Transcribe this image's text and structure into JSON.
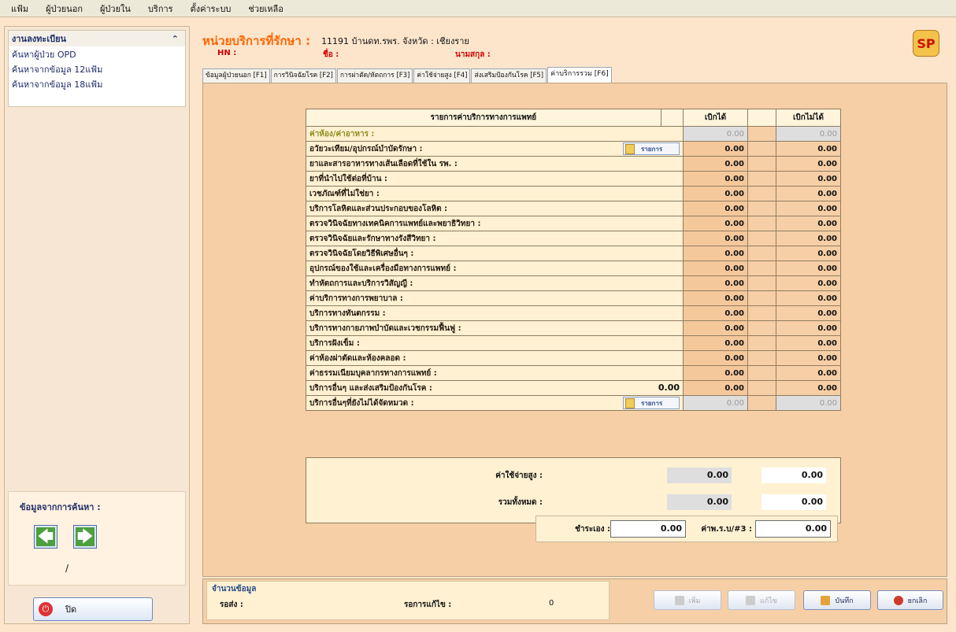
{
  "menu": [
    "แฟ้ม",
    "ผู้ป่วยนอก",
    "ผู้ป่วยใน",
    "บริการ",
    "ตั้งค่าระบบ",
    "ช่วยเหลือ"
  ],
  "sidebar": {
    "title": "งานลงทะเบียน",
    "items": [
      "ค้นหาผู้ป่วย OPD",
      "ค้นหาจากข้อมูล 12แฟ้ม",
      "ค้นหาจากข้อมูล 18แฟ้ม"
    ],
    "search_panel_label": "ข้อมูลจากการค้นหา :",
    "slash": "/",
    "close_label": "ปิด"
  },
  "header": {
    "unit_label": "หน่วยบริการที่รักษา :",
    "unit_value": "11191 บ้านดท.รพร. จังหวัด : เชียงราย",
    "hn_label": "HN :",
    "name_label": "ชื่อ :",
    "surname_label": "นามสกุล :",
    "logo_text": "SP"
  },
  "tabs": [
    "ข้อมูลผู้ป่วยนอก [F1]",
    "การวินิจฉัยโรค [F2]",
    "การผ่าตัด/หัตถการ [F3]",
    "ค่าใช้จ่ายสูง [F4]",
    "ส่งเสริมป้องกันโรค [F5]",
    "ค่าบริการรวม [F6]"
  ],
  "table": {
    "headers": [
      "รายการค่าบริการทางการแพทย์",
      "เบิกได้",
      "เบิกไม่ได้"
    ],
    "list_button_label": "รายการ",
    "rows": [
      {
        "name": "ค่าห้อง/ค่าอาหาร :",
        "a": "0.00",
        "b": "0.00"
      },
      {
        "name": "อวัยวะเทียม/อุปกรณ์บำบัดรักษา :",
        "a": "0.00",
        "b": "0.00"
      },
      {
        "name": "ยาและสารอาหารทางเส้นเลือดที่ใช้ใน รพ. :",
        "a": "0.00",
        "b": "0.00"
      },
      {
        "name": "ยาที่นำไปใช้ต่อที่บ้าน :",
        "a": "0.00",
        "b": "0.00"
      },
      {
        "name": "เวชภัณฑ์ที่ไม่ใช่ยา :",
        "a": "0.00",
        "b": "0.00"
      },
      {
        "name": "บริการโลหิตและส่วนประกอบของโลหิต :",
        "a": "0.00",
        "b": "0.00"
      },
      {
        "name": "ตรวจวินิจฉัยทางเทคนิคการแพทย์และพยาธิวิทยา :",
        "a": "0.00",
        "b": "0.00"
      },
      {
        "name": "ตรวจวินิจฉัยและรักษาทางรังสีวิทยา :",
        "a": "0.00",
        "b": "0.00"
      },
      {
        "name": "ตรวจวินิจฉัยโดยวิธีพิเศษอื่นๆ :",
        "a": "0.00",
        "b": "0.00"
      },
      {
        "name": "อุปกรณ์ของใช้และเครื่องมือทางการแพทย์ :",
        "a": "0.00",
        "b": "0.00"
      },
      {
        "name": "ทำหัตถการและบริการวิสัญญี :",
        "a": "0.00",
        "b": "0.00"
      },
      {
        "name": "ค่าบริการทางการพยาบาล :",
        "a": "0.00",
        "b": "0.00"
      },
      {
        "name": "บริการทางทันตกรรม :",
        "a": "0.00",
        "b": "0.00"
      },
      {
        "name": "บริการทางกายภาพบำบัดและเวชกรรมฟื้นฟู :",
        "a": "0.00",
        "b": "0.00"
      },
      {
        "name": "บริการฝังเข็ม :",
        "a": "0.00",
        "b": "0.00"
      },
      {
        "name": "ค่าห้องผ่าตัดและห้องคลอด :",
        "a": "0.00",
        "b": "0.00"
      },
      {
        "name": "ค่าธรรมเนียมบุคลากรทางการแพทย์ :",
        "a": "0.00",
        "b": "0.00"
      },
      {
        "name": "บริการอื่นๆ และส่งเสริมป้องกันโรค :",
        "extra": "0.00",
        "a": "0.00",
        "b": "0.00"
      },
      {
        "name": "บริการอื่นๆที่ยังไม่ได้จัดหมวด :",
        "a": "0.00",
        "b": "0.00"
      }
    ]
  },
  "summary": {
    "high_cost_label": "ค่าใช้จ่ายสูง :",
    "high_cost_a": "0.00",
    "high_cost_b": "0.00",
    "total_label": "รวมทั้งหมด :",
    "total_a": "0.00",
    "total_b": "0.00",
    "self_pay_label": "ชำระเอง :",
    "self_pay_value": "0.00",
    "ph_label": "ค่าพ.ร.บ/#3 :",
    "ph_value": "0.00"
  },
  "status": {
    "caption": "จำนวนข้อมูล",
    "send_label": "รอส่ง :",
    "edit_label": "รอการแก้ไข :",
    "edit_value": "0"
  },
  "actions": {
    "add": "เพิ่ม",
    "edit": "แก้ไข",
    "save": "บันทึก",
    "cancel": "ยกเลิก"
  }
}
